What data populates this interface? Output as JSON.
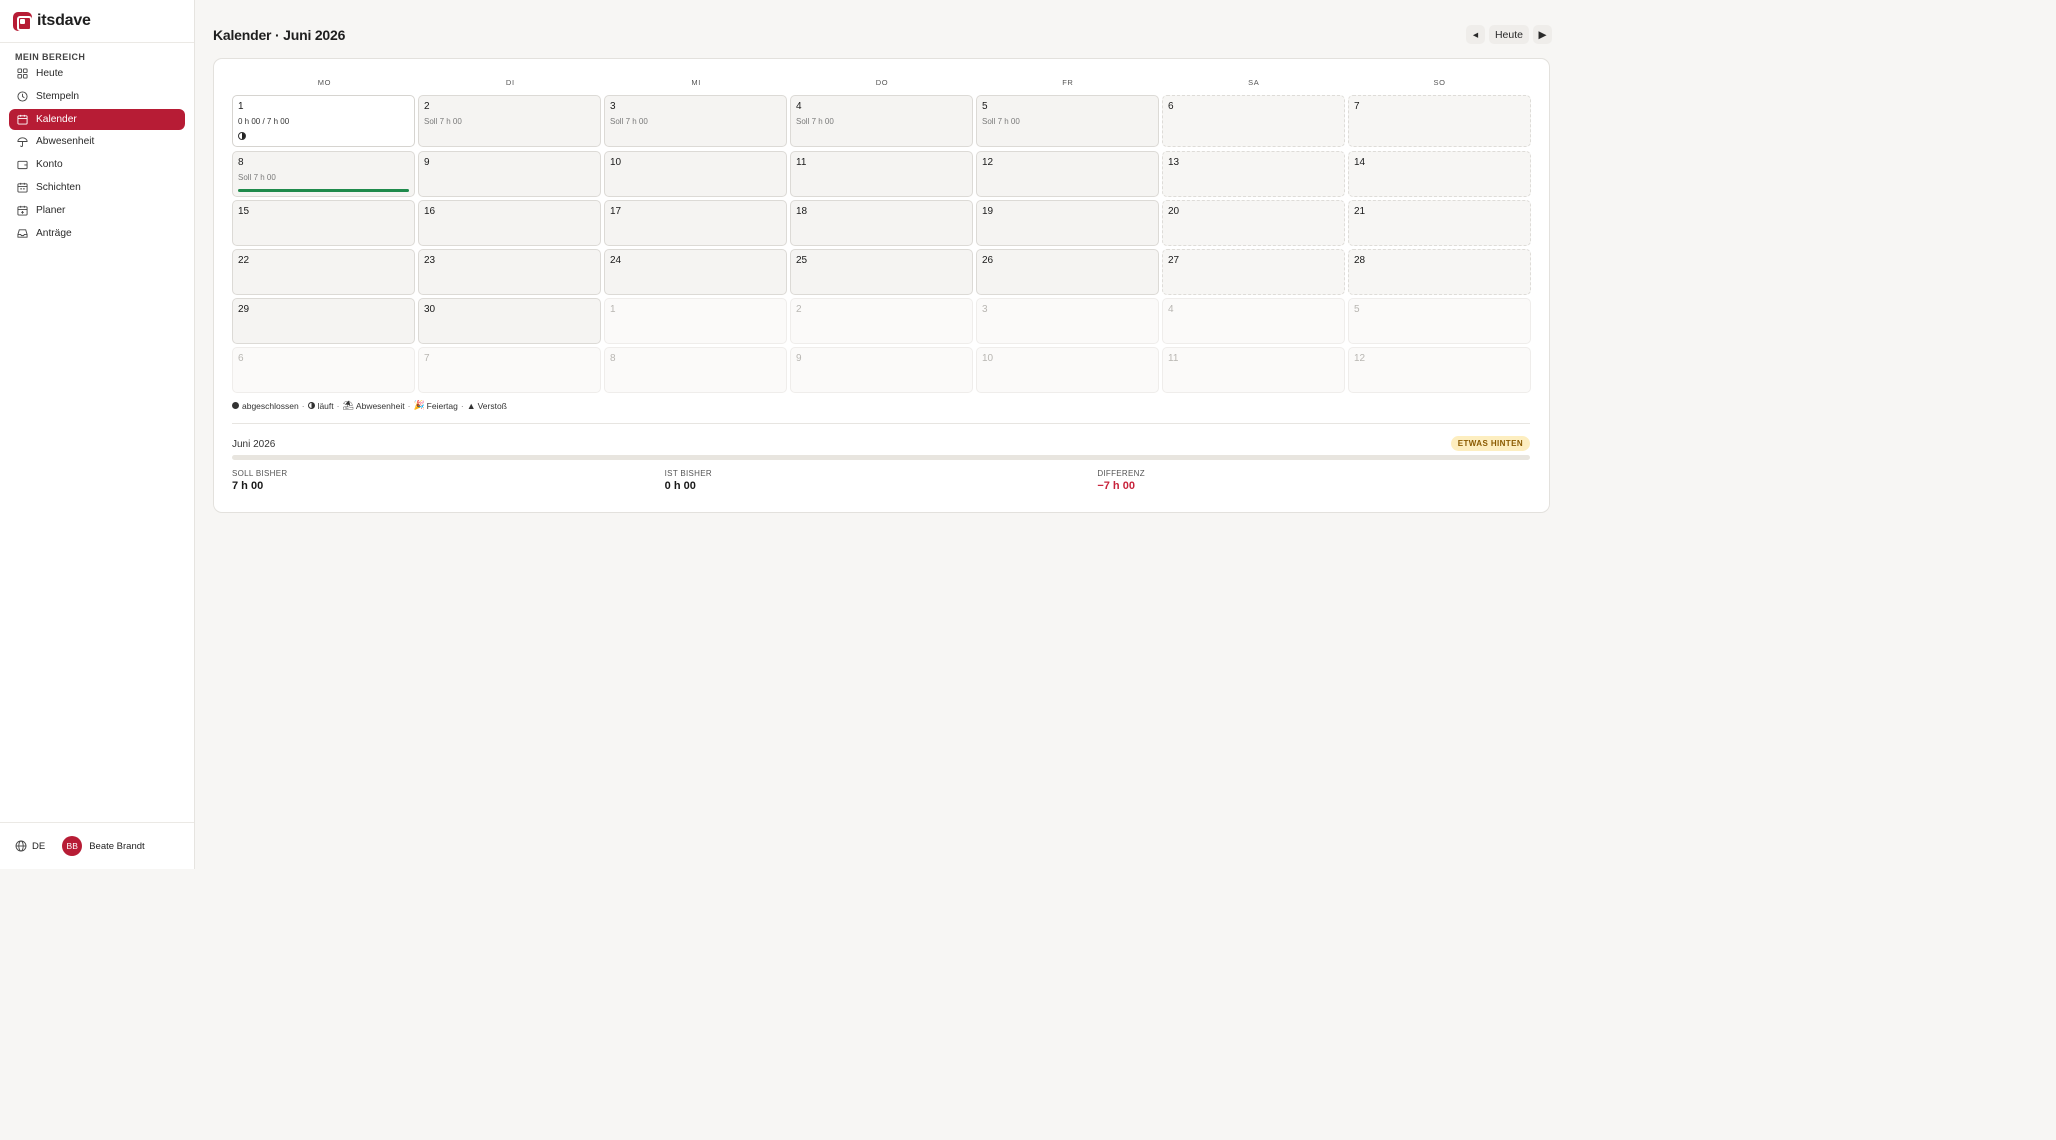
{
  "brand": {
    "name": "itsdave"
  },
  "sidebar": {
    "section_label": "MEIN BEREICH",
    "items": [
      {
        "label": "Heute",
        "icon": "grid-icon",
        "active": false
      },
      {
        "label": "Stempeln",
        "icon": "clock-icon",
        "active": false
      },
      {
        "label": "Kalender",
        "icon": "calendar-icon",
        "active": true
      },
      {
        "label": "Abwesenheit",
        "icon": "umbrella-icon",
        "active": false
      },
      {
        "label": "Konto",
        "icon": "wallet-icon",
        "active": false
      },
      {
        "label": "Schichten",
        "icon": "calendar-shift-icon",
        "active": false
      },
      {
        "label": "Planer",
        "icon": "planner-icon",
        "active": false
      },
      {
        "label": "Anträge",
        "icon": "inbox-icon",
        "active": false
      }
    ],
    "footer": {
      "language": "DE",
      "user_initials": "BB",
      "user_name": "Beate Brandt"
    }
  },
  "header": {
    "title": "Kalender · Juni 2026",
    "prev_label": "◂",
    "today_label": "Heute",
    "next_label": "▶"
  },
  "calendar": {
    "weekdays": [
      "MO",
      "DI",
      "MI",
      "DO",
      "FR",
      "SA",
      "SO"
    ],
    "weeks": [
      [
        {
          "day": "1",
          "line": "0 h 00 / 7 h 00",
          "kind": "today",
          "status": "laeuft"
        },
        {
          "day": "2",
          "line": "Soll 7 h 00",
          "kind": "normal"
        },
        {
          "day": "3",
          "line": "Soll 7 h 00",
          "kind": "normal"
        },
        {
          "day": "4",
          "line": "Soll 7 h 00",
          "kind": "normal"
        },
        {
          "day": "5",
          "line": "Soll 7 h 00",
          "kind": "normal"
        },
        {
          "day": "6",
          "line": "",
          "kind": "weekend"
        },
        {
          "day": "7",
          "line": "",
          "kind": "weekend"
        }
      ],
      [
        {
          "day": "8",
          "line": "Soll 7 h 00",
          "kind": "normal",
          "progress": 1.0
        },
        {
          "day": "9",
          "line": "",
          "kind": "normal"
        },
        {
          "day": "10",
          "line": "",
          "kind": "normal"
        },
        {
          "day": "11",
          "line": "",
          "kind": "normal"
        },
        {
          "day": "12",
          "line": "",
          "kind": "normal"
        },
        {
          "day": "13",
          "line": "",
          "kind": "weekend"
        },
        {
          "day": "14",
          "line": "",
          "kind": "weekend"
        }
      ],
      [
        {
          "day": "15",
          "line": "",
          "kind": "normal"
        },
        {
          "day": "16",
          "line": "",
          "kind": "normal"
        },
        {
          "day": "17",
          "line": "",
          "kind": "normal"
        },
        {
          "day": "18",
          "line": "",
          "kind": "normal"
        },
        {
          "day": "19",
          "line": "",
          "kind": "normal"
        },
        {
          "day": "20",
          "line": "",
          "kind": "weekend"
        },
        {
          "day": "21",
          "line": "",
          "kind": "weekend"
        }
      ],
      [
        {
          "day": "22",
          "line": "",
          "kind": "normal"
        },
        {
          "day": "23",
          "line": "",
          "kind": "normal"
        },
        {
          "day": "24",
          "line": "",
          "kind": "normal"
        },
        {
          "day": "25",
          "line": "",
          "kind": "normal"
        },
        {
          "day": "26",
          "line": "",
          "kind": "normal"
        },
        {
          "day": "27",
          "line": "",
          "kind": "weekend"
        },
        {
          "day": "28",
          "line": "",
          "kind": "weekend"
        }
      ],
      [
        {
          "day": "29",
          "line": "",
          "kind": "normal"
        },
        {
          "day": "30",
          "line": "",
          "kind": "normal"
        },
        {
          "day": "1",
          "line": "",
          "kind": "outside"
        },
        {
          "day": "2",
          "line": "",
          "kind": "outside"
        },
        {
          "day": "3",
          "line": "",
          "kind": "outside"
        },
        {
          "day": "4",
          "line": "",
          "kind": "outside"
        },
        {
          "day": "5",
          "line": "",
          "kind": "outside"
        }
      ],
      [
        {
          "day": "6",
          "line": "",
          "kind": "outside"
        },
        {
          "day": "7",
          "line": "",
          "kind": "outside"
        },
        {
          "day": "8",
          "line": "",
          "kind": "outside"
        },
        {
          "day": "9",
          "line": "",
          "kind": "outside"
        },
        {
          "day": "10",
          "line": "",
          "kind": "outside"
        },
        {
          "day": "11",
          "line": "",
          "kind": "outside"
        },
        {
          "day": "12",
          "line": "",
          "kind": "outside"
        }
      ]
    ]
  },
  "legend": {
    "abgeschlossen": "abgeschlossen",
    "laeuft": "läuft",
    "abwesenheit": "Abwesenheit",
    "feiertag": "Feiertag",
    "verstoss": "Verstoß",
    "abwesenheit_glyph": "⛱",
    "feiertag_glyph": "🎉",
    "verstoss_glyph": "▲",
    "separator": "·"
  },
  "summary": {
    "month": "Juni 2026",
    "badge": "ETWAS HINTEN",
    "progress": 0.0,
    "soll_label": "SOLL BISHER",
    "soll_value": "7 h 00",
    "ist_label": "IST BISHER",
    "ist_value": "0 h 00",
    "diff_label": "DIFFERENZ",
    "diff_value": "−7 h 00"
  },
  "colors": {
    "accent": "#b71c35",
    "progress_green": "#1f8a4c",
    "negative": "#c8233b",
    "badge_bg": "#fdeec0"
  }
}
